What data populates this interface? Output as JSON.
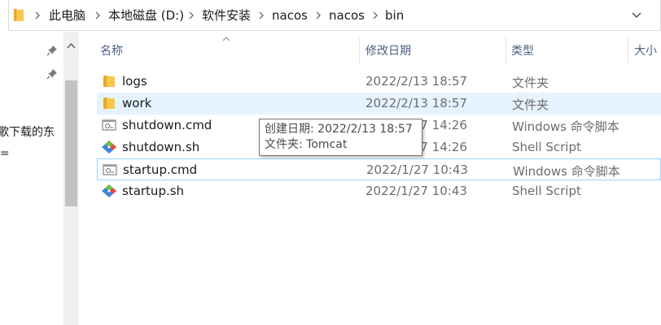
{
  "address_bar": {
    "breadcrumbs": [
      "此电脑",
      "本地磁盘 (D:)",
      "软件安装",
      "nacos",
      "nacos",
      "bin"
    ],
    "icon": "folder-icon",
    "dropdown_icon": "chevron-down-icon"
  },
  "nav_pane": {
    "items": [
      {
        "icon": "pin-icon"
      },
      {
        "icon": "pin-icon"
      }
    ],
    "partial_text_1": "歌下载的东",
    "partial_text_2": "="
  },
  "columns": {
    "name": "名称",
    "date_modified": "修改日期",
    "type": "类型",
    "size": "大小"
  },
  "files": [
    {
      "name": "logs",
      "date": "2022/2/13 18:57",
      "type": "文件夹",
      "icon": "folder-icon"
    },
    {
      "name": "work",
      "date": "2022/2/13 18:57",
      "type": "文件夹",
      "icon": "folder-icon",
      "selected": true
    },
    {
      "name": "shutdown.cmd",
      "date": "2022/1/27 14:26",
      "type": "Windows 命令脚本",
      "icon": "cmd-file-icon"
    },
    {
      "name": "shutdown.sh",
      "date": "2022/1/27 14:26",
      "type": "Shell Script",
      "icon": "git-bash-icon"
    },
    {
      "name": "startup.cmd",
      "date": "2022/1/27 10:43",
      "type": "Windows 命令脚本",
      "icon": "cmd-file-icon",
      "focused": true
    },
    {
      "name": "startup.sh",
      "date": "2022/1/27 10:43",
      "type": "Shell Script",
      "icon": "git-bash-icon"
    }
  ],
  "tooltip": {
    "line1": "创建日期: 2022/2/13 18:57",
    "line2": "文件夹: Tomcat"
  },
  "colors": {
    "selection": "#e5f3ff",
    "focus_border": "#99d1ff",
    "header_text": "#4d6082",
    "folder": "#f8c64b"
  }
}
